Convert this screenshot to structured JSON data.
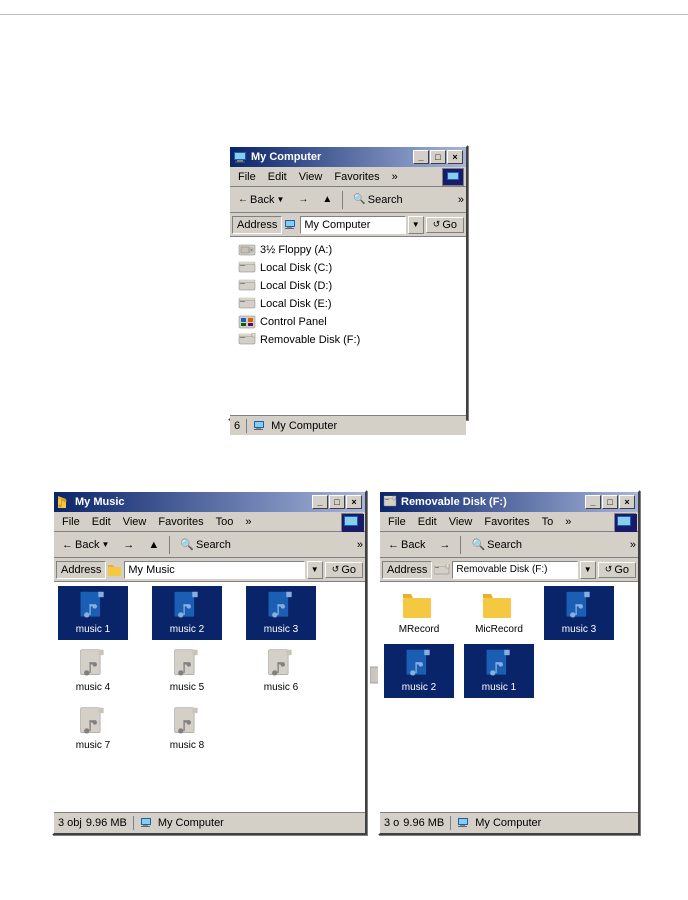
{
  "mycomputer": {
    "title": "My Computer",
    "menu": [
      "File",
      "Edit",
      "View",
      "Favorites",
      "»"
    ],
    "toolbar": {
      "back": "← Back",
      "forward": "→",
      "up": "▲",
      "search": "🔍 Search",
      "more": "»"
    },
    "address_label": "Address",
    "address_value": "My Computer",
    "go": "Go",
    "drives": [
      {
        "label": "3½ Floppy (A:)"
      },
      {
        "label": "Local Disk (C:)"
      },
      {
        "label": "Local Disk (D:)"
      },
      {
        "label": "Local Disk (E:)"
      },
      {
        "label": "Control Panel"
      },
      {
        "label": "Removable Disk (F:)"
      }
    ],
    "status_count": "6",
    "status_label": "My Computer"
  },
  "mymusic": {
    "title": "My Music",
    "menu": [
      "File",
      "Edit",
      "View",
      "Favorites",
      "Too",
      "»"
    ],
    "address_label": "Address",
    "address_value": "My Music",
    "go": "Go",
    "files": [
      {
        "label": "music 1",
        "selected": true
      },
      {
        "label": "music 2",
        "selected": true
      },
      {
        "label": "music 3",
        "selected": true
      },
      {
        "label": "music 4",
        "selected": false
      },
      {
        "label": "music 5",
        "selected": false
      },
      {
        "label": "music 6",
        "selected": false
      },
      {
        "label": "music 7",
        "selected": false
      },
      {
        "label": "music 8",
        "selected": false
      }
    ],
    "status_count": "3 obj",
    "status_size": "9.96 MB",
    "status_label": "My Computer"
  },
  "removable": {
    "title": "Removable Disk (F:)",
    "menu": [
      "File",
      "Edit",
      "View",
      "Favorites",
      "To",
      "»"
    ],
    "address_label": "Address",
    "address_value": "Removable Disk (F:)",
    "go": "Go",
    "items": [
      {
        "label": "MRecord",
        "type": "folder"
      },
      {
        "label": "MicRecord",
        "type": "folder"
      },
      {
        "label": "music 3",
        "type": "music",
        "selected": true
      },
      {
        "label": "music 2",
        "type": "music",
        "selected": true
      },
      {
        "label": "music 1",
        "type": "music",
        "selected": true
      }
    ],
    "status_count": "3 o",
    "status_size": "9.96 MB",
    "status_label": "My Computer"
  },
  "arrow": {
    "symbol": "➜"
  }
}
